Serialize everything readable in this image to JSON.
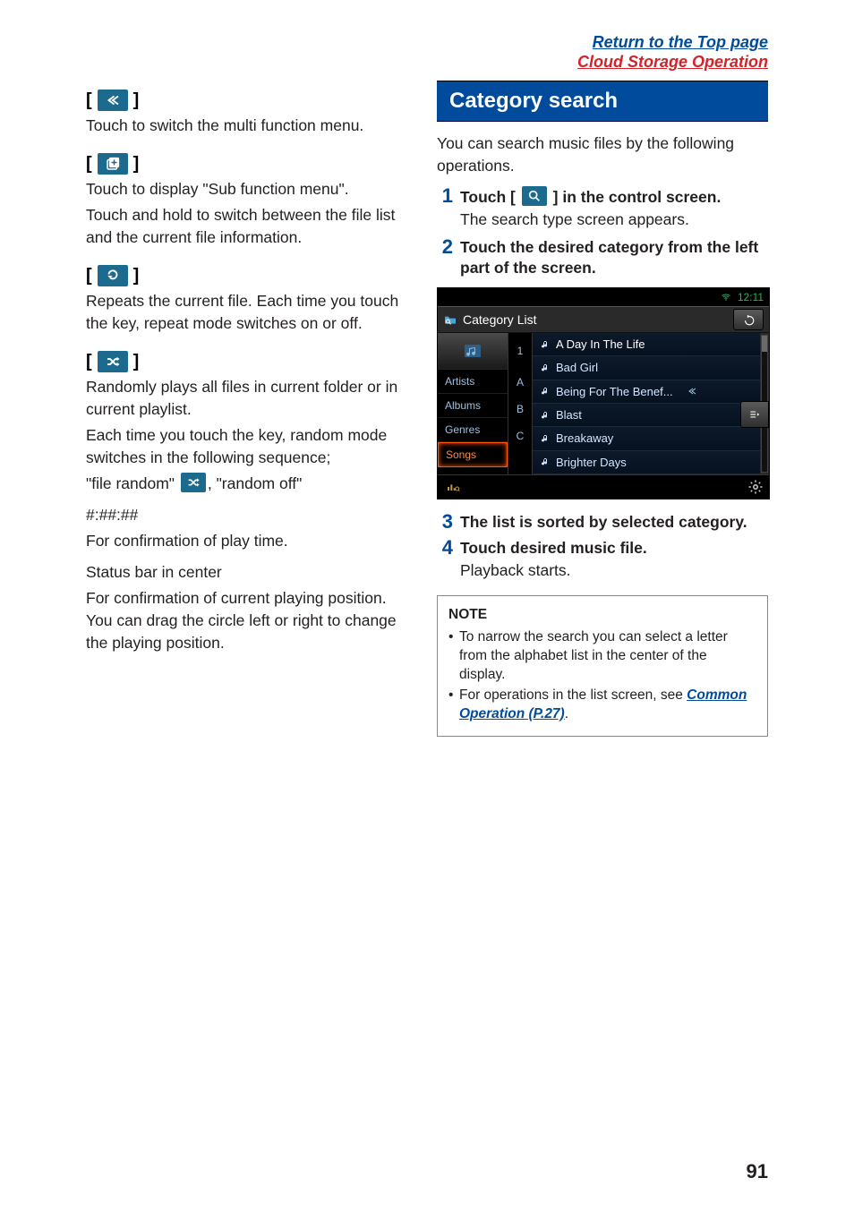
{
  "header": {
    "top_link": "Return to the Top page",
    "section_link": "Cloud Storage Operation"
  },
  "left": {
    "multi_desc": "Touch to switch the multi function menu.",
    "sub_desc1": "Touch to display \"Sub function menu\".",
    "sub_desc2": "Touch and hold to switch between the file list and the current file information.",
    "repeat_desc": "Repeats the current file. Each time you touch the key, repeat mode switches on or off.",
    "random_desc1": "Randomly plays all files in current folder or in current playlist.",
    "random_desc2": "Each time you touch the key, random mode switches in the following sequence;",
    "random_seq1": "\"file random\" ",
    "random_seq2": ", \"random off\"",
    "time_label": "#:##:##",
    "time_desc": "For confirmation of play time.",
    "status_label": "Status bar in center",
    "status_desc": "For confirmation of current playing position. You can drag the circle left or right to change the playing position."
  },
  "right": {
    "section_title": "Category search",
    "intro": "You can search music files by the following operations.",
    "step1a": "Touch [",
    "step1b": "] in the control screen.",
    "step1_sub": "The search type screen appears.",
    "step2": "Touch the desired category from the left part of the screen.",
    "step3": "The list is sorted by selected category.",
    "step4": "Touch desired music file.",
    "step4_sub": "Playback starts.",
    "note_title": "NOTE",
    "note1": "To narrow the search you can select a letter from the alphabet list in the center of the display.",
    "note2a": "For operations in the list screen, see ",
    "note2b": "Common Operation (P.27)",
    "note2c": "."
  },
  "shot": {
    "time": "12:11",
    "title": "Category List",
    "cats": [
      "Artists",
      "Albums",
      "Genres",
      "Songs"
    ],
    "alpha": [
      "1",
      "A",
      "B",
      "C"
    ],
    "songs": [
      "A Day In The Life",
      "Bad Girl",
      "Being For The Benef...",
      "Blast",
      "Breakaway",
      "Brighter Days"
    ]
  },
  "page_number": "91"
}
